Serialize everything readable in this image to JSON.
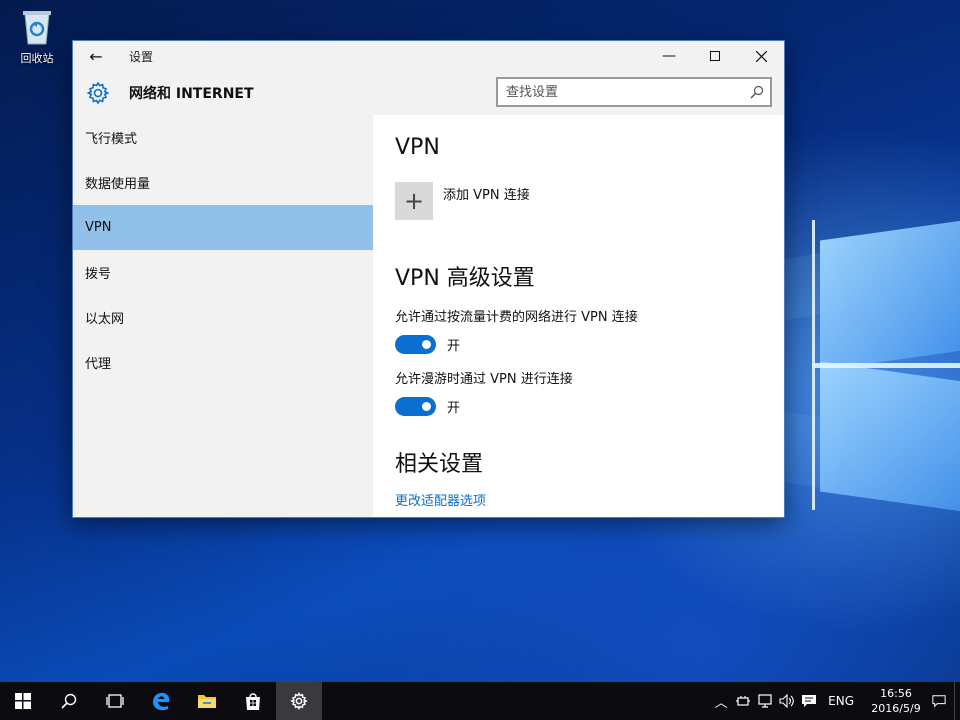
{
  "desktop": {
    "icons": [
      {
        "label": "回收站",
        "icon": "recycle-bin-icon"
      }
    ]
  },
  "window": {
    "title": "设置",
    "header_title": "网络和 INTERNET",
    "search": {
      "placeholder": "查找设置",
      "value": ""
    },
    "nav": [
      {
        "label": "飞行模式",
        "active": false
      },
      {
        "label": "数据使用量",
        "active": false
      },
      {
        "label": "VPN",
        "active": true
      },
      {
        "label": "拨号",
        "active": false
      },
      {
        "label": "以太网",
        "active": false
      },
      {
        "label": "代理",
        "active": false
      }
    ],
    "content": {
      "heading": "VPN",
      "add_vpn_label": "添加 VPN 连接",
      "advanced_heading": "VPN 高级设置",
      "options": [
        {
          "label": "允许通过按流量计费的网络进行 VPN 连接",
          "state": "开",
          "on": true
        },
        {
          "label": "允许漫游时通过 VPN 进行连接",
          "state": "开",
          "on": true
        }
      ],
      "related_heading": "相关设置",
      "related_link": "更改适配器选项"
    }
  },
  "taskbar": {
    "language": "ENG",
    "time": "16:56",
    "date": "2016/5/9"
  },
  "colors": {
    "accent": "#0a6fd1",
    "nav_active": "#91c0e8",
    "panel_bg": "#f2f2f2",
    "taskbar_bg": "#0c0c10"
  }
}
